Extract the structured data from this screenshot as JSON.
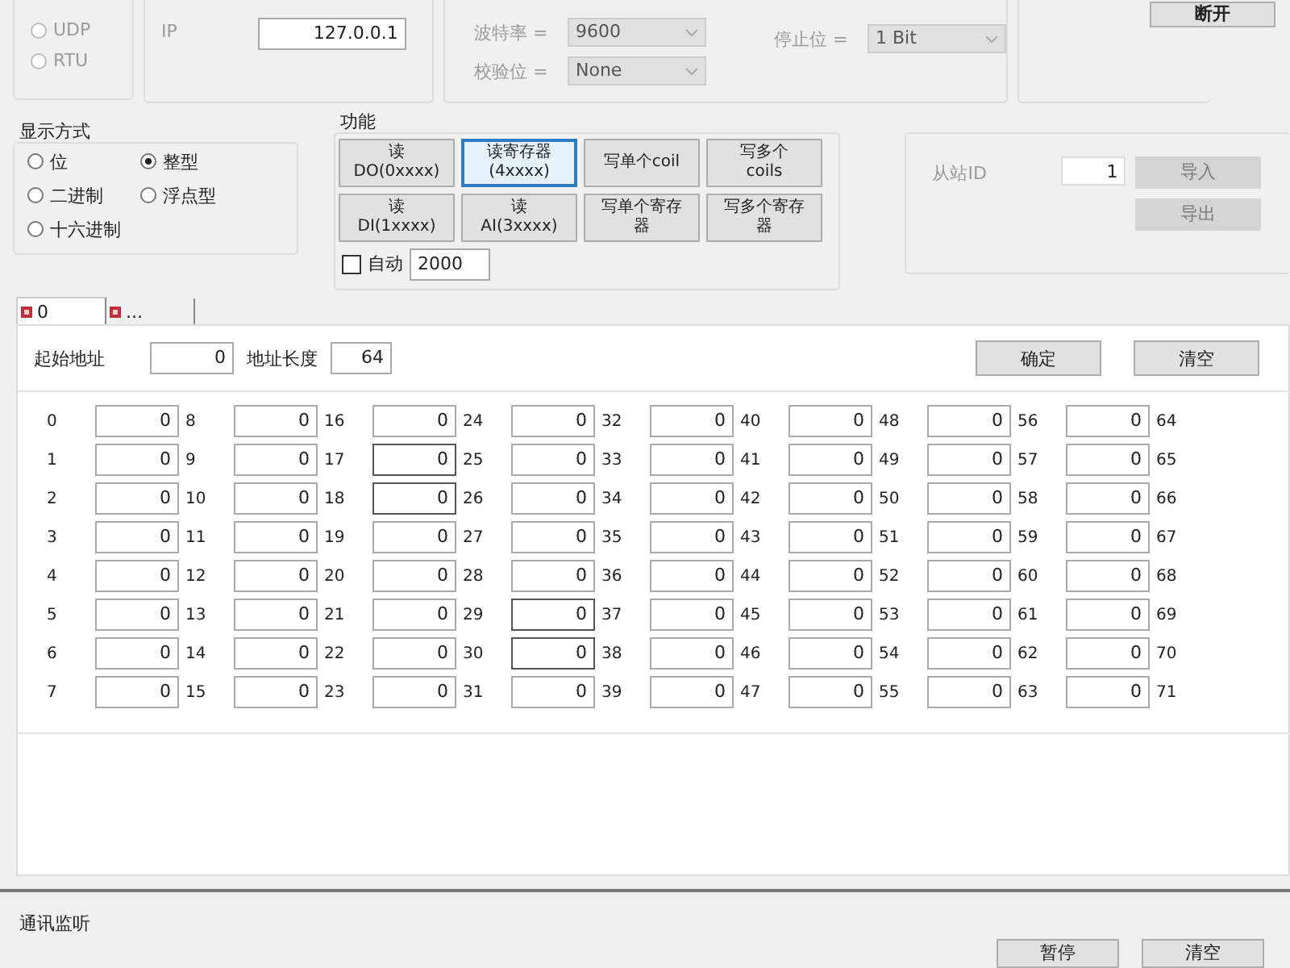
{
  "connection": {
    "protocols": [
      {
        "label": "UDP",
        "selected": false
      },
      {
        "label": "RTU",
        "selected": false
      }
    ],
    "ip_label": "IP",
    "ip": "127.0.0.1",
    "serial_left": [
      {
        "label": "波特率 =",
        "value": "9600"
      },
      {
        "label": "校验位 =",
        "value": "None"
      }
    ],
    "serial_right": [
      {
        "label": "停止位 =",
        "value": "1 Bit"
      }
    ],
    "disconnect": "断开"
  },
  "display_mode": {
    "title": "显示方式",
    "options": [
      {
        "label": "位",
        "selected": false
      },
      {
        "label": "整型",
        "selected": true
      },
      {
        "label": "二进制",
        "selected": false
      },
      {
        "label": "浮点型",
        "selected": false
      },
      {
        "label": "十六进制",
        "selected": false
      }
    ]
  },
  "functions": {
    "title": "功能",
    "buttons": [
      {
        "lines": [
          "读",
          "DO(0xxxx)"
        ],
        "selected": false
      },
      {
        "lines": [
          "读寄存器",
          "(4xxxx)"
        ],
        "selected": true
      },
      {
        "lines": [
          "写单个coil"
        ],
        "selected": false
      },
      {
        "lines": [
          "写多个",
          "coils"
        ],
        "selected": false
      },
      {
        "lines": [
          "读",
          "DI(1xxxx)"
        ],
        "selected": false
      },
      {
        "lines": [
          "读",
          "AI(3xxxx)"
        ],
        "selected": false
      },
      {
        "lines": [
          "写单个寄存",
          "器"
        ],
        "selected": false
      },
      {
        "lines": [
          "写多个寄存",
          "器"
        ],
        "selected": false
      }
    ],
    "auto": {
      "label": "自动",
      "checked": false,
      "interval": "2000"
    }
  },
  "slave": {
    "id_label": "从站ID",
    "id": "1",
    "buttons": [
      {
        "label": "导入",
        "disabled": true
      },
      {
        "label": "导出",
        "disabled": true
      }
    ]
  },
  "tabs": [
    {
      "label": "0",
      "selected": true
    },
    {
      "label": "...",
      "selected": false
    }
  ],
  "address": {
    "start_label": "起始地址",
    "start": "0",
    "length_label": "地址长度",
    "length": "64",
    "confirm": "确定",
    "clear": "清空"
  },
  "register_rows": [
    {
      "cells": [
        {
          "address": "0",
          "value": "0",
          "highlighted": false
        },
        {
          "address": "8",
          "value": "0",
          "highlighted": false
        },
        {
          "address": "16",
          "value": "0",
          "highlighted": false
        },
        {
          "address": "24",
          "value": "0",
          "highlighted": false
        },
        {
          "address": "32",
          "value": "0",
          "highlighted": false
        },
        {
          "address": "40",
          "value": "0",
          "highlighted": false
        },
        {
          "address": "48",
          "value": "0",
          "highlighted": false
        },
        {
          "address": "56",
          "value": "0",
          "highlighted": false
        },
        {
          "address": "64"
        }
      ]
    },
    {
      "cells": [
        {
          "address": "1",
          "value": "0",
          "highlighted": false
        },
        {
          "address": "9",
          "value": "0",
          "highlighted": false
        },
        {
          "address": "17",
          "value": "0",
          "highlighted": true
        },
        {
          "address": "25",
          "value": "0",
          "highlighted": false
        },
        {
          "address": "33",
          "value": "0",
          "highlighted": false
        },
        {
          "address": "41",
          "value": "0",
          "highlighted": false
        },
        {
          "address": "49",
          "value": "0",
          "highlighted": false
        },
        {
          "address": "57",
          "value": "0",
          "highlighted": false
        },
        {
          "address": "65"
        }
      ]
    },
    {
      "cells": [
        {
          "address": "2",
          "value": "0",
          "highlighted": false
        },
        {
          "address": "10",
          "value": "0",
          "highlighted": false
        },
        {
          "address": "18",
          "value": "0",
          "highlighted": true
        },
        {
          "address": "26",
          "value": "0",
          "highlighted": false
        },
        {
          "address": "34",
          "value": "0",
          "highlighted": false
        },
        {
          "address": "42",
          "value": "0",
          "highlighted": false
        },
        {
          "address": "50",
          "value": "0",
          "highlighted": false
        },
        {
          "address": "58",
          "value": "0",
          "highlighted": false
        },
        {
          "address": "66"
        }
      ]
    },
    {
      "cells": [
        {
          "address": "3",
          "value": "0",
          "highlighted": false
        },
        {
          "address": "11",
          "value": "0",
          "highlighted": false
        },
        {
          "address": "19",
          "value": "0",
          "highlighted": false
        },
        {
          "address": "27",
          "value": "0",
          "highlighted": false
        },
        {
          "address": "35",
          "value": "0",
          "highlighted": false
        },
        {
          "address": "43",
          "value": "0",
          "highlighted": false
        },
        {
          "address": "51",
          "value": "0",
          "highlighted": false
        },
        {
          "address": "59",
          "value": "0",
          "highlighted": false
        },
        {
          "address": "67"
        }
      ]
    },
    {
      "cells": [
        {
          "address": "4",
          "value": "0",
          "highlighted": false
        },
        {
          "address": "12",
          "value": "0",
          "highlighted": false
        },
        {
          "address": "20",
          "value": "0",
          "highlighted": false
        },
        {
          "address": "28",
          "value": "0",
          "highlighted": false
        },
        {
          "address": "36",
          "value": "0",
          "highlighted": false
        },
        {
          "address": "44",
          "value": "0",
          "highlighted": false
        },
        {
          "address": "52",
          "value": "0",
          "highlighted": false
        },
        {
          "address": "60",
          "value": "0",
          "highlighted": false
        },
        {
          "address": "68"
        }
      ]
    },
    {
      "cells": [
        {
          "address": "5",
          "value": "0",
          "highlighted": false
        },
        {
          "address": "13",
          "value": "0",
          "highlighted": false
        },
        {
          "address": "21",
          "value": "0",
          "highlighted": false
        },
        {
          "address": "29",
          "value": "0",
          "highlighted": true
        },
        {
          "address": "37",
          "value": "0",
          "highlighted": false
        },
        {
          "address": "45",
          "value": "0",
          "highlighted": false
        },
        {
          "address": "53",
          "value": "0",
          "highlighted": false
        },
        {
          "address": "61",
          "value": "0",
          "highlighted": false
        },
        {
          "address": "69"
        }
      ]
    },
    {
      "cells": [
        {
          "address": "6",
          "value": "0",
          "highlighted": false
        },
        {
          "address": "14",
          "value": "0",
          "highlighted": false
        },
        {
          "address": "22",
          "value": "0",
          "highlighted": false
        },
        {
          "address": "30",
          "value": "0",
          "highlighted": true
        },
        {
          "address": "38",
          "value": "0",
          "highlighted": false
        },
        {
          "address": "46",
          "value": "0",
          "highlighted": false
        },
        {
          "address": "54",
          "value": "0",
          "highlighted": false
        },
        {
          "address": "62",
          "value": "0",
          "highlighted": false
        },
        {
          "address": "70"
        }
      ]
    },
    {
      "cells": [
        {
          "address": "7",
          "value": "0",
          "highlighted": false
        },
        {
          "address": "15",
          "value": "0",
          "highlighted": false
        },
        {
          "address": "23",
          "value": "0",
          "highlighted": false
        },
        {
          "address": "31",
          "value": "0",
          "highlighted": false
        },
        {
          "address": "39",
          "value": "0",
          "highlighted": false
        },
        {
          "address": "47",
          "value": "0",
          "highlighted": false
        },
        {
          "address": "55",
          "value": "0",
          "highlighted": false
        },
        {
          "address": "63",
          "value": "0",
          "highlighted": false
        },
        {
          "address": "71"
        }
      ]
    }
  ],
  "monitor": {
    "title": "通讯监听",
    "buttons": [
      "暂停",
      "清空"
    ]
  }
}
